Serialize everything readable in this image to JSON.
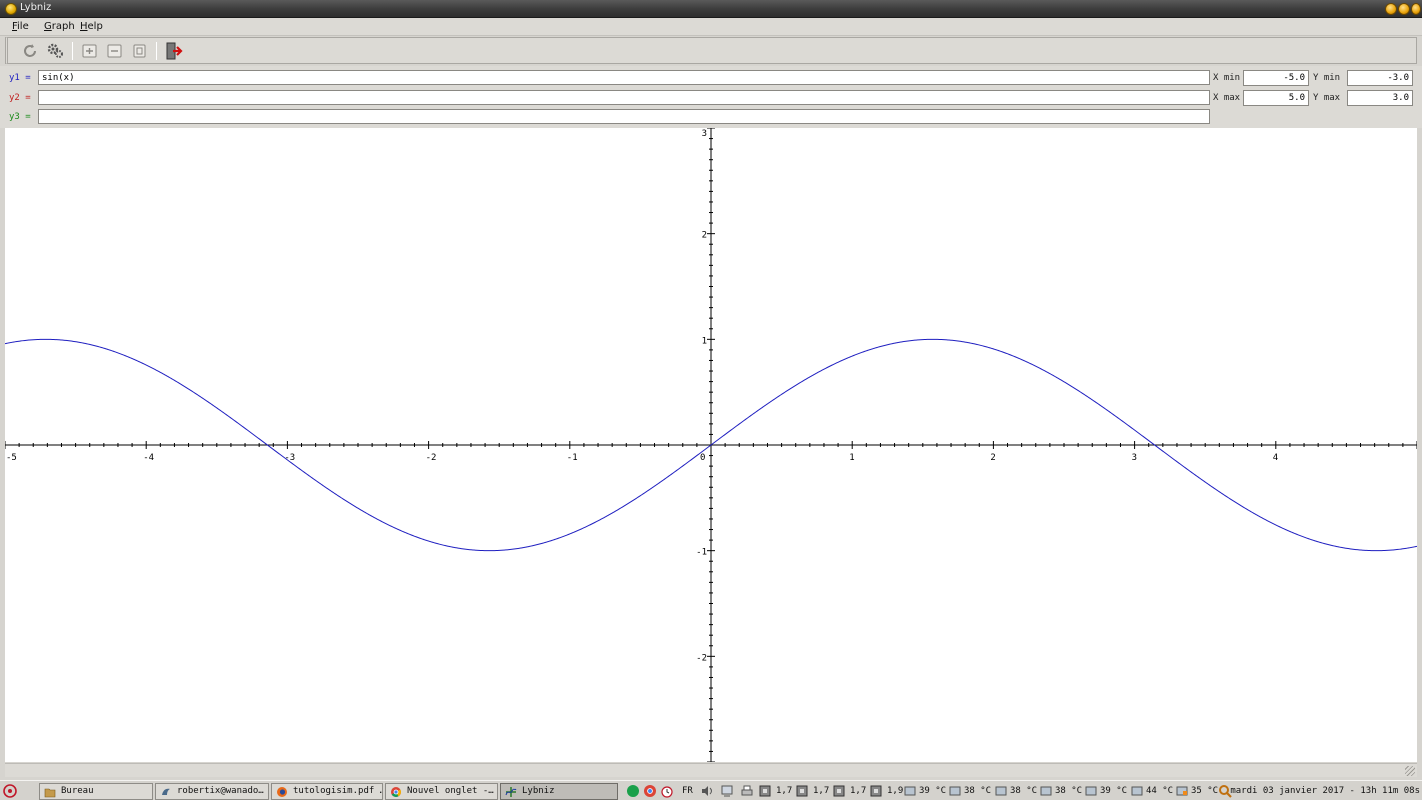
{
  "window": {
    "title": "Lybniz"
  },
  "menu": [
    "File",
    "Graph",
    "Help"
  ],
  "toolbar": [
    {
      "name": "reload-icon"
    },
    {
      "name": "settings-icon"
    },
    {
      "name": "zoom-in-icon"
    },
    {
      "name": "zoom-out-icon"
    },
    {
      "name": "zoom-reset-icon"
    },
    {
      "name": "quit-icon"
    }
  ],
  "functions": [
    {
      "label": "y1 =",
      "value": "sin(x)",
      "color": "#1f1fc0"
    },
    {
      "label": "y2 =",
      "value": "",
      "color": "#c02020"
    },
    {
      "label": "y3 =",
      "value": "",
      "color": "#1a8a1a"
    }
  ],
  "range": {
    "xmin_label": "X min",
    "xmin": "-5.0",
    "xmax_label": "X max",
    "xmax": "5.0",
    "ymin_label": "Y min",
    "ymin": "-3.0",
    "ymax_label": "Y max",
    "ymax": "3.0"
  },
  "chart_data": {
    "type": "line",
    "series": [
      {
        "name": "sin(x)",
        "function": "sin",
        "color": "#1f1fc0"
      }
    ],
    "xlim": [
      -5,
      5
    ],
    "ylim": [
      -3,
      3
    ],
    "x_ticks": [
      "-5",
      "-4",
      "-3",
      "-2",
      "-1",
      "0",
      "1",
      "2",
      "3",
      "4"
    ],
    "y_ticks": [
      "-2",
      "-1",
      "1",
      "2",
      "3"
    ],
    "minor_ticks_per_unit": 10
  },
  "taskbar": {
    "tasks": [
      {
        "label": "Bureau",
        "icon": "folder-icon",
        "active": false
      },
      {
        "label": "robertix@wanado…",
        "icon": "mail-icon",
        "active": false
      },
      {
        "label": "tutologisim.pdf …",
        "icon": "firefox-icon",
        "active": false
      },
      {
        "label": "Nouvel onglet -…",
        "icon": "chrome-icon",
        "active": false
      },
      {
        "label": "Lybniz",
        "icon": "lybniz-icon",
        "active": true
      }
    ],
    "tray": {
      "lang": "FR",
      "cpu": [
        "1,7",
        "1,7",
        "1,7",
        "1,9"
      ],
      "temps": [
        "39 °C",
        "38 °C",
        "38 °C",
        "38 °C",
        "39 °C",
        "44 °C",
        "35 °C"
      ],
      "clock": "mardi 03 janvier 2017 - 13h 11m 08s"
    }
  },
  "colors": {
    "curve": "#1f1fc0",
    "axis": "#000000"
  }
}
